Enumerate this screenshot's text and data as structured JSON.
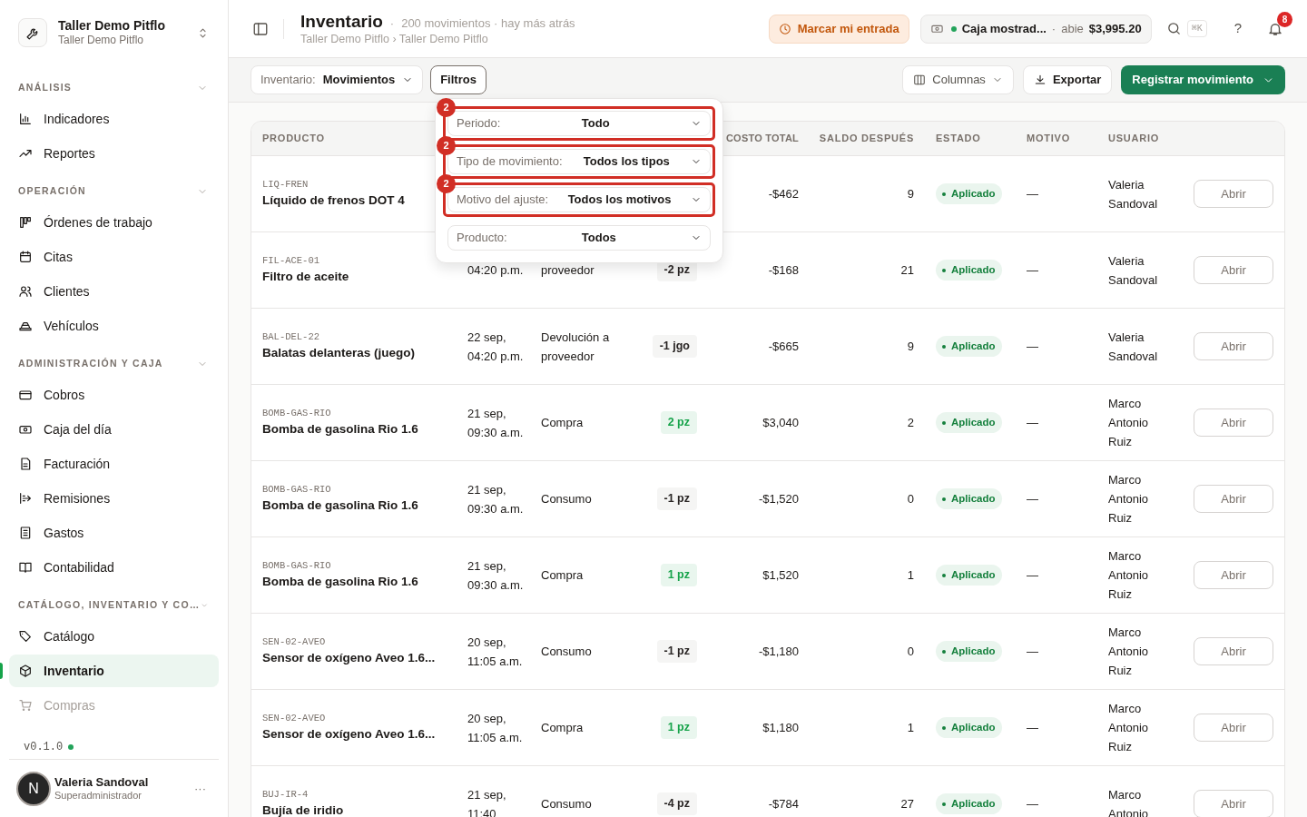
{
  "workspace": {
    "name": "Taller Demo Pitflo",
    "subtitle": "Taller Demo Pitflo"
  },
  "sidebar": {
    "sections": [
      {
        "title": "ANÁLISIS",
        "expanded": true,
        "items": [
          {
            "label": "Indicadores",
            "selected": false,
            "faded": false
          },
          {
            "label": "Reportes",
            "selected": false,
            "faded": false
          }
        ]
      },
      {
        "title": "OPERACIÓN",
        "expanded": true,
        "items": [
          {
            "label": "Órdenes de trabajo",
            "selected": false,
            "faded": false
          },
          {
            "label": "Citas",
            "selected": false,
            "faded": false
          },
          {
            "label": "Clientes",
            "selected": false,
            "faded": false
          },
          {
            "label": "Vehículos",
            "selected": false,
            "faded": false
          }
        ]
      },
      {
        "title": "ADMINISTRACIÓN Y CAJA",
        "expanded": true,
        "items": [
          {
            "label": "Cobros",
            "selected": false,
            "faded": false
          },
          {
            "label": "Caja del día",
            "selected": false,
            "faded": false
          },
          {
            "label": "Facturación",
            "selected": false,
            "faded": false
          },
          {
            "label": "Remisiones",
            "selected": false,
            "faded": false
          },
          {
            "label": "Gastos",
            "selected": false,
            "faded": false
          },
          {
            "label": "Contabilidad",
            "selected": false,
            "faded": false
          }
        ]
      },
      {
        "title": "CATÁLOGO, INVENTARIO Y CO…",
        "expanded": true,
        "items": [
          {
            "label": "Catálogo",
            "selected": false,
            "faded": false
          },
          {
            "label": "Inventario",
            "selected": true,
            "faded": false
          },
          {
            "label": "Compras",
            "selected": false,
            "faded": true
          }
        ]
      }
    ],
    "version": "v0.1.0",
    "user": {
      "initial": "N",
      "name": "Valeria Sandoval",
      "role": "Superadministrador",
      "menu": "···"
    }
  },
  "header": {
    "title": "Inventario",
    "separator": "·",
    "summary": "200 movimientos · hay más atrás",
    "breadcrumb": "Taller Demo Pitflo › Taller Demo Pitflo",
    "clock_in": "Marcar mi entrada",
    "register": {
      "name": "Caja mostrad...",
      "separator": "·",
      "state": "abie",
      "amount": "$3,995.20"
    },
    "shortcut": "⌘K",
    "help": "?",
    "notifications": "8"
  },
  "toolbar": {
    "view_label": "Inventario:",
    "view_value": "Movimientos",
    "filters": "Filtros",
    "columns": "Columnas",
    "export": "Exportar",
    "primary": "Registrar movimiento"
  },
  "filters_popover": [
    {
      "label": "Periodo:",
      "value": "Todo",
      "highlighted": true,
      "badge": "2"
    },
    {
      "label": "Tipo de movimiento:",
      "value": "Todos los tipos",
      "highlighted": true,
      "badge": "2"
    },
    {
      "label": "Motivo del ajuste:",
      "value": "Todos los motivos",
      "highlighted": true,
      "badge": "2"
    },
    {
      "label": "Producto:",
      "value": "Todos",
      "highlighted": false
    }
  ],
  "table": {
    "columns": [
      "PRODUCTO",
      "COSTO TOTAL",
      "SALDO DESPUÉS",
      "ESTADO",
      "MOTIVO",
      "USUARIO"
    ],
    "rows": [
      {
        "sku": "LIQ-FREN",
        "product": "Líquido de frenos DOT 4",
        "cost": "-$462",
        "balance": "9",
        "status": "Aplicado",
        "reason": "—",
        "user": "Valeria Sandoval",
        "action": "Abrir"
      },
      {
        "sku": "FIL-ACE-01",
        "product": "Filtro de aceite",
        "date": "04:20 p.m.",
        "type": "proveedor",
        "qty": "-2 pz",
        "kind": "out",
        "cost": "-$168",
        "balance": "21",
        "status": "Aplicado",
        "reason": "—",
        "user": "Valeria Sandoval",
        "action": "Abrir"
      },
      {
        "sku": "BAL-DEL-22",
        "product": "Balatas delanteras (juego)",
        "date": "22 sep, 04:20 p.m.",
        "type": "Devolución a proveedor",
        "qty": "-1 jgo",
        "kind": "out",
        "cost": "-$665",
        "balance": "9",
        "status": "Aplicado",
        "reason": "—",
        "user": "Valeria Sandoval",
        "action": "Abrir"
      },
      {
        "sku": "BOMB-GAS-RIO",
        "product": "Bomba de gasolina Rio 1.6",
        "date": "21 sep, 09:30 a.m.",
        "type": "Compra",
        "qty": "2 pz",
        "kind": "in",
        "cost": "$3,040",
        "balance": "2",
        "status": "Aplicado",
        "reason": "—",
        "user": "Marco Antonio Ruiz",
        "action": "Abrir"
      },
      {
        "sku": "BOMB-GAS-RIO",
        "product": "Bomba de gasolina Rio 1.6",
        "date": "21 sep, 09:30 a.m.",
        "type": "Consumo",
        "qty": "-1 pz",
        "kind": "out",
        "cost": "-$1,520",
        "balance": "0",
        "status": "Aplicado",
        "reason": "—",
        "user": "Marco Antonio Ruiz",
        "action": "Abrir"
      },
      {
        "sku": "BOMB-GAS-RIO",
        "product": "Bomba de gasolina Rio 1.6",
        "date": "21 sep, 09:30 a.m.",
        "type": "Compra",
        "qty": "1 pz",
        "kind": "in",
        "cost": "$1,520",
        "balance": "1",
        "status": "Aplicado",
        "reason": "—",
        "user": "Marco Antonio Ruiz",
        "action": "Abrir"
      },
      {
        "sku": "SEN-02-AVEO",
        "product": "Sensor de oxígeno Aveo 1.6...",
        "date": "20 sep, 11:05 a.m.",
        "type": "Consumo",
        "qty": "-1 pz",
        "kind": "out",
        "cost": "-$1,180",
        "balance": "0",
        "status": "Aplicado",
        "reason": "—",
        "user": "Marco Antonio Ruiz",
        "action": "Abrir"
      },
      {
        "sku": "SEN-02-AVEO",
        "product": "Sensor de oxígeno Aveo 1.6...",
        "date": "20 sep, 11:05 a.m.",
        "type": "Compra",
        "qty": "1 pz",
        "kind": "in",
        "cost": "$1,180",
        "balance": "1",
        "status": "Aplicado",
        "reason": "—",
        "user": "Marco Antonio Ruiz",
        "action": "Abrir"
      },
      {
        "sku": "BUJ-IR-4",
        "product": "Bujía de iridio",
        "date": "21 sep, 11:40",
        "type": "Consumo",
        "qty": "-4 pz",
        "kind": "out",
        "cost": "-$784",
        "balance": "27",
        "status": "Aplicado",
        "reason": "—",
        "user": "Marco Antonio",
        "action": "Abrir"
      }
    ]
  }
}
